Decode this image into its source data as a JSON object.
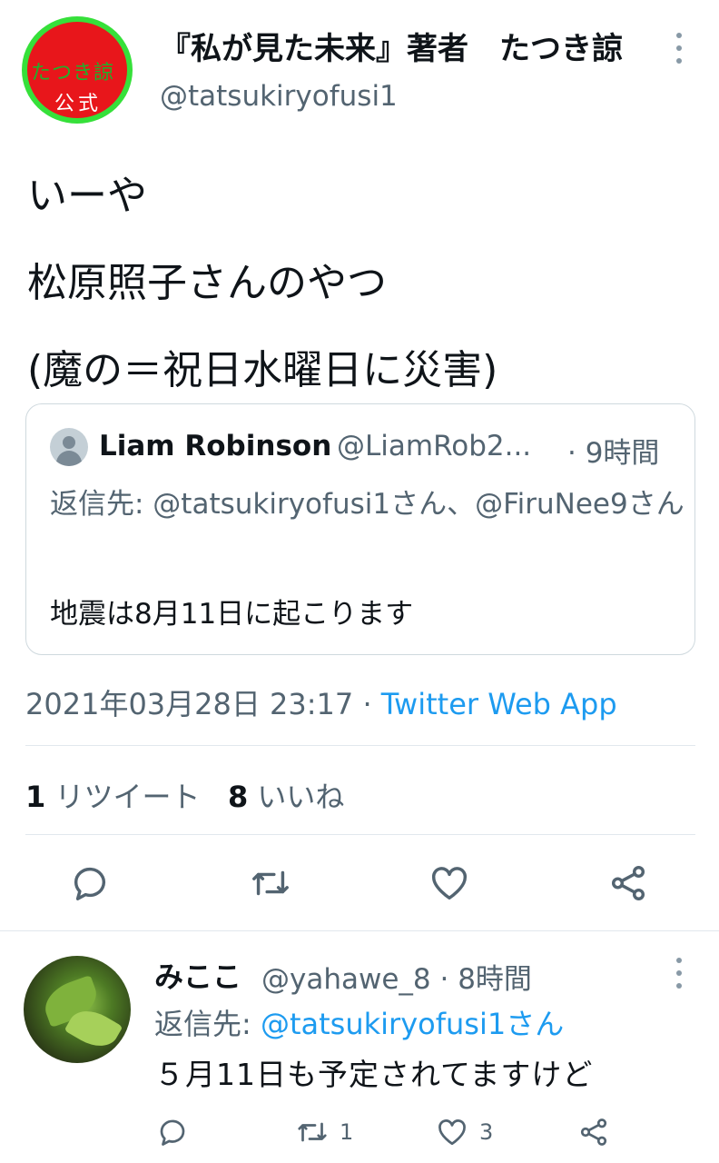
{
  "main_tweet": {
    "avatar": {
      "line1": "たつき諒",
      "line2": "公式",
      "colors": {
        "fill": "#e8161b",
        "ring": "#36e03a"
      }
    },
    "display_name": "『私が見た未来』著者　たつき諒",
    "handle": "@tatsukiryofusi1",
    "text_lines": [
      "いーや",
      "松原照子さんのやつ",
      "(魔の＝祝日水曜日に災害)"
    ],
    "quoted": {
      "name": "Liam Robinson",
      "handle": "@LiamRob2...",
      "time": "· 9時間",
      "reply_to": "返信先: @tatsukiryofusi1さん、@FiruNee9さん",
      "body": "地震は8月11日に起こります"
    },
    "timestamp": "2021年03月28日 23:17 · ",
    "source_app": "Twitter Web App",
    "stats": {
      "retweets_count": "1",
      "retweets_label": " リツイート",
      "likes_count": "8",
      "likes_label": " いいね"
    },
    "actions": [
      "reply-icon",
      "retweet-icon",
      "like-icon",
      "share-icon"
    ]
  },
  "reply_tweet": {
    "name": "みここ",
    "handle": "@yahawe_8 · 8時間",
    "reply_prefix": "返信先: ",
    "reply_mention": "@tatsukiryofusi1さん",
    "body": "５月11日も予定されてますけど",
    "retweet_count": "1",
    "like_count": "3"
  },
  "colors": {
    "link": "#1d9bf0",
    "secondary": "#536471",
    "icon": "#536471"
  }
}
